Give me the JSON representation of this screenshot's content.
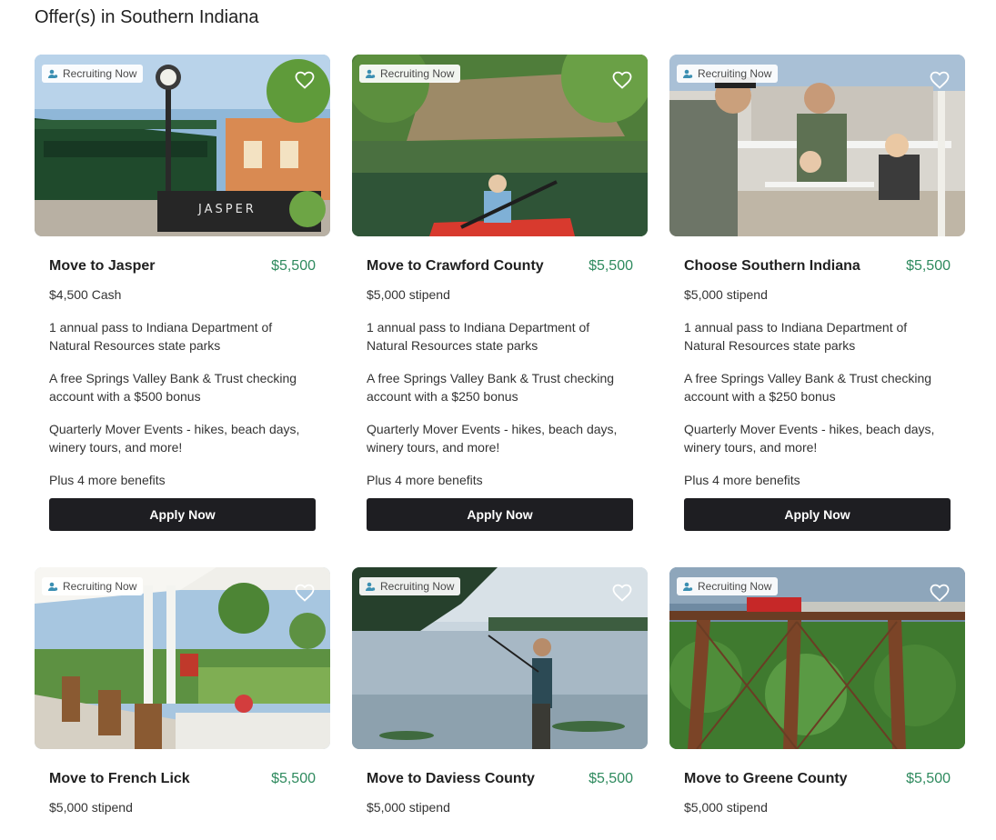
{
  "page": {
    "title": "Offer(s) in Southern Indiana"
  },
  "badge_label": "Recruiting Now",
  "colors": {
    "price": "#2e8a5e",
    "button": "#1e1e22"
  },
  "cards": [
    {
      "title": "Move to Jasper",
      "price": "$5,500",
      "cash": "$4,500 Cash",
      "benefits": [
        "1 annual pass to Indiana Department of Natural Resources state parks",
        "A free Springs Valley Bank & Trust checking account with a $500 bonus",
        "Quarterly Mover Events - hikes, beach days, winery tours, and more!"
      ],
      "more": "Plus 4 more benefits",
      "button": "Apply Now"
    },
    {
      "title": "Move to Crawford County",
      "price": "$5,500",
      "cash": "$5,000 stipend",
      "benefits": [
        "1 annual pass to Indiana Department of Natural Resources state parks",
        "A free Springs Valley Bank & Trust checking account with a $250 bonus",
        "Quarterly Mover Events - hikes, beach days, winery tours, and more!"
      ],
      "more": "Plus 4 more benefits",
      "button": "Apply Now"
    },
    {
      "title": "Choose Southern Indiana",
      "price": "$5,500",
      "cash": "$5,000 stipend",
      "benefits": [
        "1 annual pass to Indiana Department of Natural Resources state parks",
        "A free Springs Valley Bank & Trust checking account with a $250 bonus",
        "Quarterly Mover Events - hikes, beach days, winery tours, and more!"
      ],
      "more": "Plus 4 more benefits",
      "button": "Apply Now"
    },
    {
      "title": "Move to French Lick",
      "price": "$5,500",
      "cash": "$5,000 stipend"
    },
    {
      "title": "Move to Daviess County",
      "price": "$5,500",
      "cash": "$5,000 stipend"
    },
    {
      "title": "Move to Greene County",
      "price": "$5,500",
      "cash": "$5,000 stipend"
    }
  ]
}
